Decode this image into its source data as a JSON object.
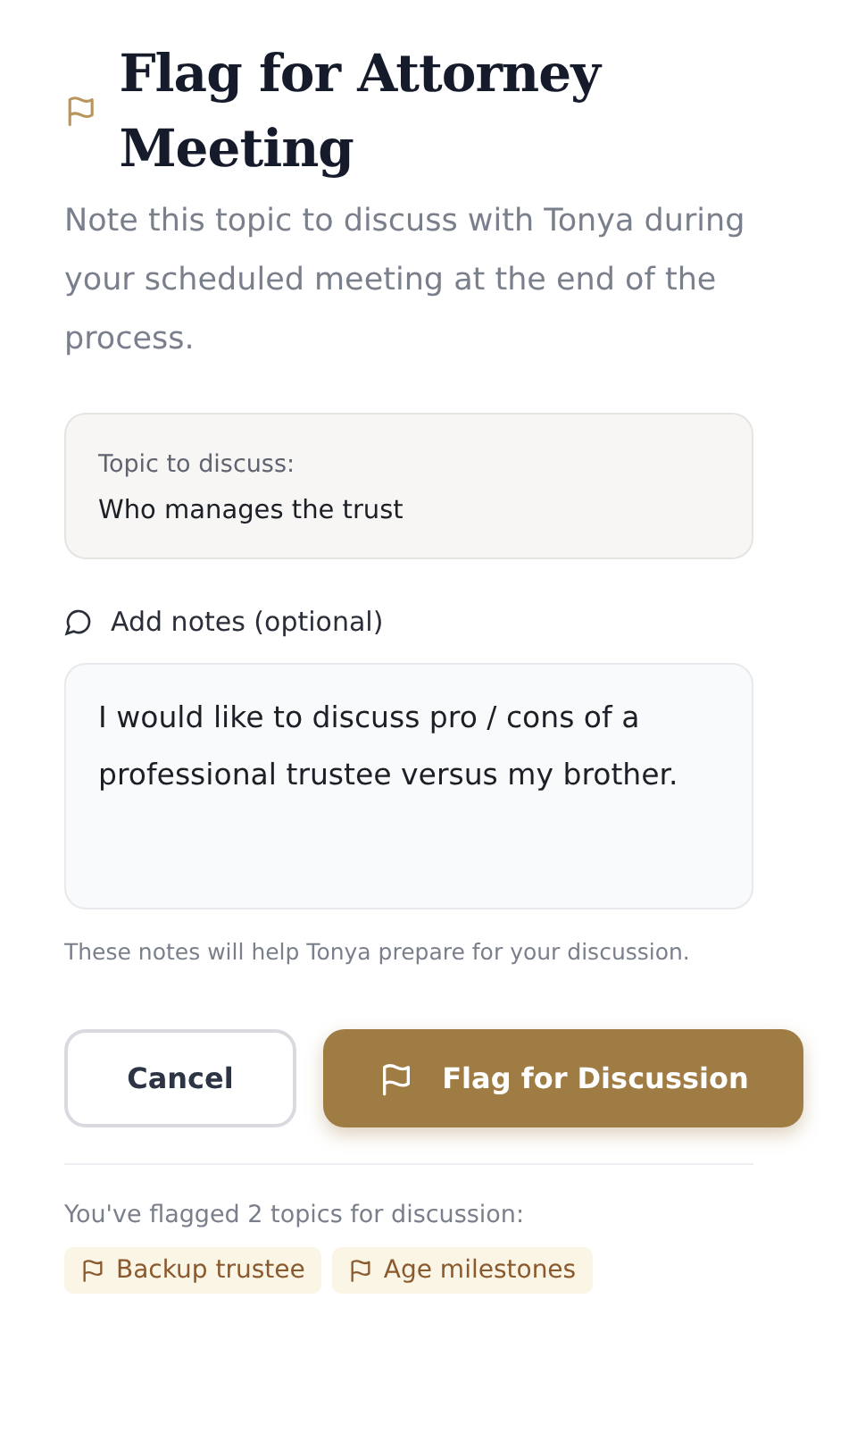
{
  "header": {
    "title": "Flag for Attorney Meeting",
    "description": "Note this topic to discuss with Tonya during your scheduled meeting at the end of the process."
  },
  "topic": {
    "label": "Topic to discuss:",
    "value": "Who manages the trust"
  },
  "notes": {
    "label": "Add notes (optional)",
    "value": "I would like to discuss pro / cons of a professional trustee versus my brother.",
    "help": "These notes will help Tonya prepare for your discussion."
  },
  "buttons": [
    {
      "kind": "secondary",
      "label": "Cancel"
    },
    {
      "kind": "primary",
      "label": "Flag for Discussion"
    }
  ],
  "flagged": {
    "summary": "You've flagged 2 topics for discussion:",
    "topics": [
      "Backup trustee",
      "Age milestones"
    ]
  }
}
